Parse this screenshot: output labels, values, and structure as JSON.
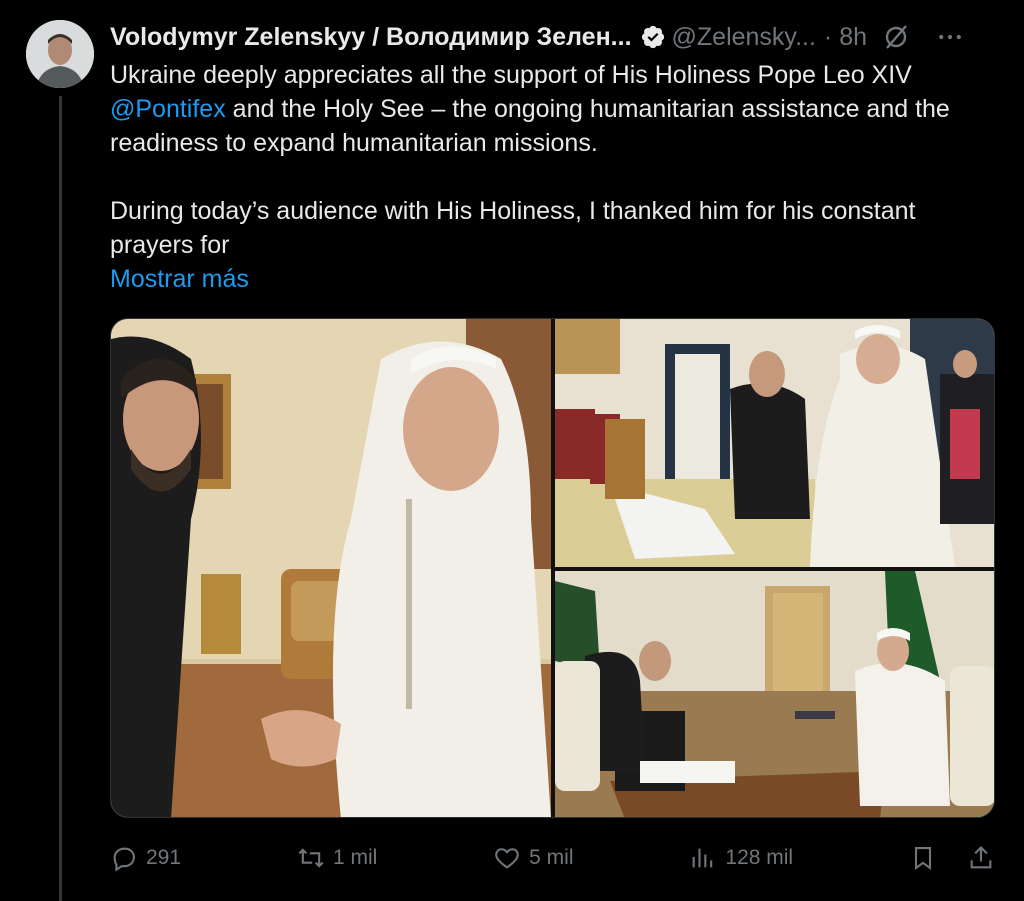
{
  "author": {
    "display_name": "Volodymyr Zelenskyy / Володимир Зелен...",
    "handle": "@Zelensky...",
    "time": "· 8h",
    "verified": true
  },
  "tweet": {
    "paragraph1_pre": "Ukraine deeply appreciates all the support of His Holiness Pope Leo XIV ",
    "mention": "@Pontifex",
    "paragraph1_post": " and the Holy See – the ongoing humanitarian assistance and the readiness to expand humanitarian missions.",
    "paragraph2": "During today’s audience with His Holiness, I thanked him for his constant prayers for",
    "show_more": "Mostrar más"
  },
  "metrics": {
    "replies": "291",
    "reposts": "1 mil",
    "likes": "5 mil",
    "views": "128 mil"
  },
  "colors": {
    "background": "#000000",
    "text": "#e7e9ea",
    "muted": "#71767b",
    "accent": "#1d9bf0"
  },
  "icons": [
    "verified-icon",
    "grok-icon",
    "more-icon",
    "reply-icon",
    "repost-icon",
    "like-icon",
    "views-icon",
    "bookmark-icon",
    "share-icon"
  ]
}
